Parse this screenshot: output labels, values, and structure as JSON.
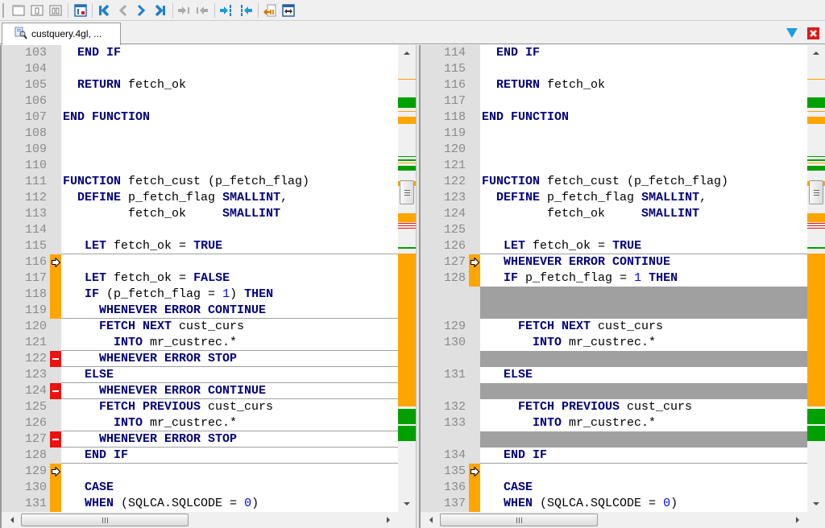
{
  "toolbar": {
    "buttons": [
      {
        "name": "single-pane-icon",
        "tooltip": ""
      },
      {
        "name": "split-left-icon",
        "tooltip": ""
      },
      {
        "name": "split-two-icon",
        "tooltip": ""
      },
      {
        "name": "show-diff-panel-icon",
        "tooltip": ""
      },
      {
        "name": "first-difference-icon",
        "tooltip": ""
      },
      {
        "name": "previous-difference-icon",
        "tooltip": ""
      },
      {
        "name": "next-difference-icon",
        "tooltip": ""
      },
      {
        "name": "last-difference-icon",
        "tooltip": ""
      },
      {
        "name": "copy-left-to-right-icon",
        "tooltip": ""
      },
      {
        "name": "copy-right-to-left-icon",
        "tooltip": ""
      },
      {
        "name": "copy-all-left-to-right-icon",
        "tooltip": ""
      },
      {
        "name": "copy-all-right-to-left-icon",
        "tooltip": ""
      },
      {
        "name": "merge-file-icon",
        "tooltip": ""
      },
      {
        "name": "fit-width-icon",
        "tooltip": ""
      }
    ]
  },
  "tab": {
    "label": "custquery.4gl, ..."
  },
  "colors": {
    "change": "#ffa500",
    "add": "#00a000",
    "remove": "#ee1111",
    "filler": "#a0a0a0",
    "keyword": "#000080",
    "number": "#0000ff",
    "line_number": "#8a8a8a",
    "gutter": "#e0e0e0"
  },
  "left": {
    "lines": [
      {
        "num": "103",
        "code": [
          [
            "  ",
            ""
          ],
          [
            "END IF",
            "kw"
          ]
        ]
      },
      {
        "num": "104",
        "code": []
      },
      {
        "num": "105",
        "code": [
          [
            "  ",
            ""
          ],
          [
            "RETURN",
            "kw"
          ],
          [
            " fetch_ok",
            ""
          ]
        ]
      },
      {
        "num": "106",
        "code": []
      },
      {
        "num": "107",
        "code": [
          [
            "END FUNCTION",
            "kw"
          ]
        ]
      },
      {
        "num": "108",
        "code": []
      },
      {
        "num": "109",
        "code": []
      },
      {
        "num": "110",
        "code": []
      },
      {
        "num": "111",
        "code": [
          [
            "FUNCTION",
            "kw"
          ],
          [
            " fetch_cust (p_fetch_flag)",
            ""
          ]
        ]
      },
      {
        "num": "112",
        "code": [
          [
            "  ",
            ""
          ],
          [
            "DEFINE",
            "kw"
          ],
          [
            " p_fetch_flag ",
            ""
          ],
          [
            "SMALLINT",
            "kw"
          ],
          [
            ",",
            ""
          ]
        ]
      },
      {
        "num": "113",
        "code": [
          [
            "         fetch_ok     ",
            ""
          ],
          [
            "SMALLINT",
            "kw"
          ]
        ]
      },
      {
        "num": "114",
        "code": []
      },
      {
        "num": "115",
        "code": [
          [
            "   ",
            ""
          ],
          [
            "LET",
            "kw"
          ],
          [
            " fetch_ok = ",
            ""
          ],
          [
            "TRUE",
            "kw"
          ]
        ]
      },
      {
        "num": "116",
        "code": [],
        "mark": "change",
        "arrow": true
      },
      {
        "num": "117",
        "code": [
          [
            "   ",
            ""
          ],
          [
            "LET",
            "kw"
          ],
          [
            " fetch_ok = ",
            ""
          ],
          [
            "FALSE",
            "kw"
          ]
        ],
        "mark": "change"
      },
      {
        "num": "118",
        "code": [
          [
            "   ",
            ""
          ],
          [
            "IF",
            "kw"
          ],
          [
            " (p_fetch_flag = ",
            ""
          ],
          [
            "1",
            "num"
          ],
          [
            ") ",
            ""
          ],
          [
            "THEN",
            "kw"
          ]
        ],
        "mark": "change"
      },
      {
        "num": "119",
        "code": [
          [
            "     ",
            ""
          ],
          [
            "WHENEVER ERROR CONTINUE",
            "kw"
          ]
        ],
        "mark": "change"
      },
      {
        "num": "120",
        "code": [
          [
            "     ",
            ""
          ],
          [
            "FETCH NEXT",
            "kw"
          ],
          [
            " cust_curs",
            ""
          ]
        ]
      },
      {
        "num": "121",
        "code": [
          [
            "       ",
            ""
          ],
          [
            "INTO",
            "kw"
          ],
          [
            " mr_custrec.*",
            ""
          ]
        ]
      },
      {
        "num": "122",
        "code": [
          [
            "     ",
            ""
          ],
          [
            "WHENEVER ERROR STOP",
            "kw"
          ]
        ],
        "mark": "remove"
      },
      {
        "num": "123",
        "code": [
          [
            "   ",
            ""
          ],
          [
            "ELSE",
            "kw"
          ]
        ]
      },
      {
        "num": "124",
        "code": [
          [
            "     ",
            ""
          ],
          [
            "WHENEVER ERROR CONTINUE",
            "kw"
          ]
        ],
        "mark": "remove"
      },
      {
        "num": "125",
        "code": [
          [
            "     ",
            ""
          ],
          [
            "FETCH PREVIOUS",
            "kw"
          ],
          [
            " cust_curs",
            ""
          ]
        ]
      },
      {
        "num": "126",
        "code": [
          [
            "       ",
            ""
          ],
          [
            "INTO",
            "kw"
          ],
          [
            " mr_custrec.*",
            ""
          ]
        ]
      },
      {
        "num": "127",
        "code": [
          [
            "     ",
            ""
          ],
          [
            "WHENEVER ERROR STOP",
            "kw"
          ]
        ],
        "mark": "remove"
      },
      {
        "num": "128",
        "code": [
          [
            "   ",
            ""
          ],
          [
            "END IF",
            "kw"
          ]
        ]
      },
      {
        "num": "129",
        "code": [],
        "mark": "change",
        "arrow": true
      },
      {
        "num": "130",
        "code": [
          [
            "   ",
            ""
          ],
          [
            "CASE",
            "kw"
          ]
        ],
        "mark": "change"
      },
      {
        "num": "131",
        "code": [
          [
            "   ",
            ""
          ],
          [
            "WHEN",
            "kw"
          ],
          [
            " (SQLCA.SQLCODE = ",
            ""
          ],
          [
            "0",
            "num"
          ],
          [
            ")",
            ""
          ]
        ],
        "mark": "change"
      }
    ],
    "separators_after_rows": [
      12,
      16,
      18,
      19,
      20,
      21,
      23,
      24,
      25
    ]
  },
  "right": {
    "rows": [
      {
        "num": "114",
        "code": [
          [
            "  ",
            ""
          ],
          [
            "END IF",
            "kw"
          ]
        ]
      },
      {
        "num": "115",
        "code": []
      },
      {
        "num": "116",
        "code": [
          [
            "  ",
            ""
          ],
          [
            "RETURN",
            "kw"
          ],
          [
            " fetch_ok",
            ""
          ]
        ]
      },
      {
        "num": "117",
        "code": []
      },
      {
        "num": "118",
        "code": [
          [
            "END FUNCTION",
            "kw"
          ]
        ]
      },
      {
        "num": "119",
        "code": []
      },
      {
        "num": "120",
        "code": []
      },
      {
        "num": "121",
        "code": []
      },
      {
        "num": "122",
        "code": [
          [
            "FUNCTION",
            "kw"
          ],
          [
            " fetch_cust (p_fetch_flag)",
            ""
          ]
        ]
      },
      {
        "num": "123",
        "code": [
          [
            "  ",
            ""
          ],
          [
            "DEFINE",
            "kw"
          ],
          [
            " p_fetch_flag ",
            ""
          ],
          [
            "SMALLINT",
            "kw"
          ],
          [
            ",",
            ""
          ]
        ]
      },
      {
        "num": "124",
        "code": [
          [
            "         fetch_ok     ",
            ""
          ],
          [
            "SMALLINT",
            "kw"
          ]
        ]
      },
      {
        "num": "125",
        "code": []
      },
      {
        "num": "126",
        "code": [
          [
            "   ",
            ""
          ],
          [
            "LET",
            "kw"
          ],
          [
            " fetch_ok = ",
            ""
          ],
          [
            "TRUE",
            "kw"
          ]
        ]
      },
      {
        "num": "127",
        "code": [
          [
            "   ",
            ""
          ],
          [
            "WHENEVER ERROR CONTINUE",
            "kw"
          ]
        ],
        "mark": "change",
        "arrow": true
      },
      {
        "num": "128",
        "code": [
          [
            "   ",
            ""
          ],
          [
            "IF",
            "kw"
          ],
          [
            " p_fetch_flag = ",
            ""
          ],
          [
            "1",
            "num"
          ],
          [
            " ",
            ""
          ],
          [
            "THEN",
            "kw"
          ]
        ],
        "mark": "change"
      },
      {
        "filler": true
      },
      {
        "filler": true
      },
      {
        "num": "129",
        "code": [
          [
            "     ",
            ""
          ],
          [
            "FETCH NEXT",
            "kw"
          ],
          [
            " cust_curs",
            ""
          ]
        ]
      },
      {
        "num": "130",
        "code": [
          [
            "       ",
            ""
          ],
          [
            "INTO",
            "kw"
          ],
          [
            " mr_custrec.*",
            ""
          ]
        ]
      },
      {
        "filler": true
      },
      {
        "num": "131",
        "code": [
          [
            "   ",
            ""
          ],
          [
            "ELSE",
            "kw"
          ]
        ]
      },
      {
        "filler": true
      },
      {
        "num": "132",
        "code": [
          [
            "     ",
            ""
          ],
          [
            "FETCH PREVIOUS",
            "kw"
          ],
          [
            " cust_curs",
            ""
          ]
        ]
      },
      {
        "num": "133",
        "code": [
          [
            "       ",
            ""
          ],
          [
            "INTO",
            "kw"
          ],
          [
            " mr_custrec.*",
            ""
          ]
        ]
      },
      {
        "filler": true
      },
      {
        "num": "134",
        "code": [
          [
            "   ",
            ""
          ],
          [
            "END IF",
            "kw"
          ]
        ]
      },
      {
        "num": "135",
        "code": [],
        "mark": "change",
        "arrow": true
      },
      {
        "num": "136",
        "code": [
          [
            "   ",
            ""
          ],
          [
            "CASE",
            "kw"
          ]
        ],
        "mark": "change"
      },
      {
        "num": "137",
        "code": [
          [
            "   ",
            ""
          ],
          [
            "WHEN",
            "kw"
          ],
          [
            " (SQLCA.SQLCODE = ",
            ""
          ],
          [
            "0",
            "num"
          ],
          [
            ")",
            ""
          ]
        ],
        "mark": "change"
      }
    ],
    "separators_after_rows": [
      12,
      25
    ]
  },
  "overview_markers": [
    {
      "from": 0.04,
      "to": 0.043,
      "type": "change"
    },
    {
      "from": 0.083,
      "to": 0.108,
      "type": "add"
    },
    {
      "from": 0.114,
      "to": 0.117,
      "type": "change"
    },
    {
      "from": 0.128,
      "to": 0.145,
      "type": "change"
    },
    {
      "from": 0.218,
      "to": 0.221,
      "type": "add"
    },
    {
      "from": 0.226,
      "to": 0.229,
      "type": "add"
    },
    {
      "from": 0.233,
      "to": 0.236,
      "type": "change"
    },
    {
      "from": 0.24,
      "to": 0.252,
      "type": "add"
    },
    {
      "from": 0.275,
      "to": 0.287,
      "type": "change"
    },
    {
      "from": 0.35,
      "to": 0.37,
      "type": "change"
    },
    {
      "from": 0.373,
      "to": 0.375,
      "type": "remove"
    },
    {
      "from": 0.378,
      "to": 0.38,
      "type": "remove"
    },
    {
      "from": 0.383,
      "to": 0.385,
      "type": "remove"
    },
    {
      "from": 0.427,
      "to": 0.432,
      "type": "add"
    },
    {
      "from": 0.442,
      "to": 0.795,
      "type": "change"
    },
    {
      "from": 0.8,
      "to": 0.836,
      "type": "add"
    },
    {
      "from": 0.838,
      "to": 0.874,
      "type": "add"
    }
  ],
  "scroll": {
    "left_vertical_position": 0.31,
    "right_vertical_position": 0.31,
    "left_horizontal_position": 0.0,
    "right_horizontal_position": 0.0
  }
}
